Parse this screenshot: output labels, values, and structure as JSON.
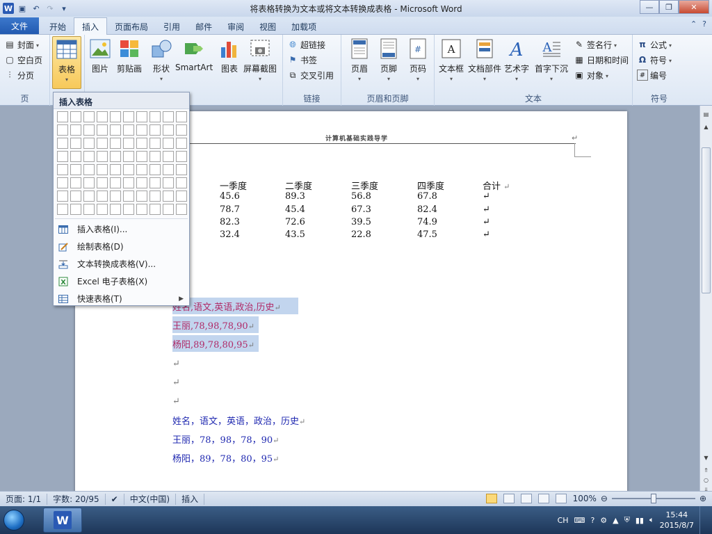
{
  "window": {
    "title": "将表格转换为文本或将文本转换成表格 - Microsoft Word",
    "logo": "W"
  },
  "tabs": {
    "file": "文件",
    "items": [
      "开始",
      "插入",
      "页面布局",
      "引用",
      "邮件",
      "审阅",
      "视图",
      "加载项"
    ],
    "active": "插入"
  },
  "ribbon": {
    "pages": {
      "label": "页",
      "cover": "封面",
      "blank": "空白页",
      "break": "分页"
    },
    "table": {
      "label": "表格",
      "button": "表格"
    },
    "illustrations": {
      "picture": "图片",
      "clipart": "剪贴画",
      "shapes": "形状",
      "smartart": "SmartArt",
      "chart": "图表",
      "screenshot": "屏幕截图"
    },
    "links": {
      "label": "链接",
      "hyperlink": "超链接",
      "bookmark": "书签",
      "crossref": "交叉引用"
    },
    "headerfooter": {
      "label": "页眉和页脚",
      "header": "页眉",
      "footer": "页脚",
      "pagenum": "页码"
    },
    "text": {
      "label": "文本",
      "textbox": "文本框",
      "quickparts": "文档部件",
      "wordart": "艺术字",
      "dropcap": "首字下沉",
      "signature": "签名行",
      "datetime": "日期和时间",
      "object": "对象"
    },
    "symbols": {
      "label": "符号",
      "equation": "公式",
      "symbol": "符号",
      "number": "编号"
    }
  },
  "dropdown": {
    "title": "插入表格",
    "items": [
      {
        "label": "插入表格(I)...",
        "icon": "table-icon"
      },
      {
        "label": "绘制表格(D)",
        "icon": "pencil-icon"
      },
      {
        "label": "文本转换成表格(V)...",
        "icon": "text-to-table-icon"
      },
      {
        "label": "Excel 电子表格(X)",
        "icon": "excel-icon"
      },
      {
        "label": "快速表格(T)",
        "icon": "quick-table-icon"
      }
    ]
  },
  "document": {
    "header": "计算机基础实践导学",
    "table": {
      "headers": [
        "一季度",
        "二季度",
        "三季度",
        "四季度",
        "合计"
      ],
      "rows": [
        [
          "45.6",
          "89.3",
          "56.8",
          "67.8"
        ],
        [
          "78.7",
          "45.4",
          "67.3",
          "82.4"
        ],
        [
          "82.3",
          "72.6",
          "39.5",
          "74.9"
        ],
        [
          "32.4",
          "43.5",
          "22.8",
          "47.5"
        ]
      ]
    },
    "selected_lines": [
      "姓名,语文,英语,政治,历史",
      "王丽,78,98,78,90",
      "杨阳,89,78,80,95"
    ],
    "blue_lines": [
      "姓名，语文，英语，政治，历史",
      "王丽，78，98，78，90",
      "杨阳，89，78，80，95"
    ],
    "para_mark": "↵"
  },
  "statusbar": {
    "page": "页面: 1/1",
    "words": "字数: 20/95",
    "language": "中文(中国)",
    "mode": "插入",
    "zoom": "100%"
  },
  "taskbar": {
    "ime": "CH",
    "time": "15:44",
    "date": "2015/8/7"
  }
}
